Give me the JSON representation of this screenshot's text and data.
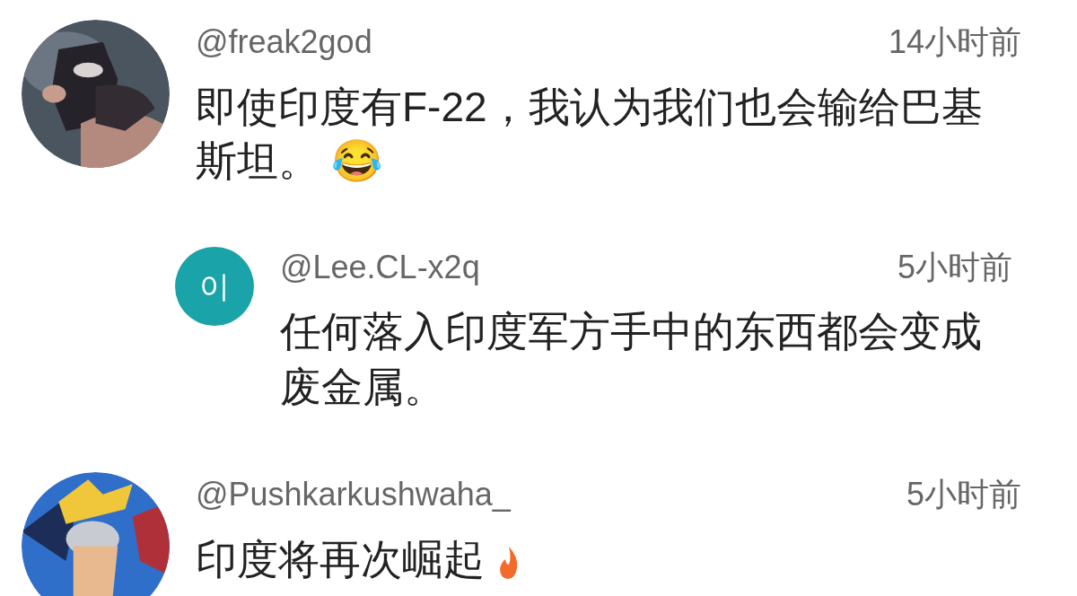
{
  "comments": [
    {
      "avatar": {
        "kind": "picture"
      },
      "username": "@freak2god",
      "time": "14小时前",
      "text": "即使印度有F-22，我认为我们也会输给巴基斯坦。 😂",
      "replies": [
        {
          "avatar": {
            "kind": "letter",
            "letter": "이",
            "color": "#1aa3a8"
          },
          "username": "@Lee.CL-x2q",
          "time": "5小时前",
          "text": "任何落入印度军方手中的东西都会变成废金属。"
        }
      ]
    },
    {
      "avatar": {
        "kind": "picture"
      },
      "username": "@Pushkarkushwaha_",
      "time": "5小时前",
      "text": "印度将再次崛起",
      "emoji": {
        "kind": "fire"
      }
    }
  ]
}
